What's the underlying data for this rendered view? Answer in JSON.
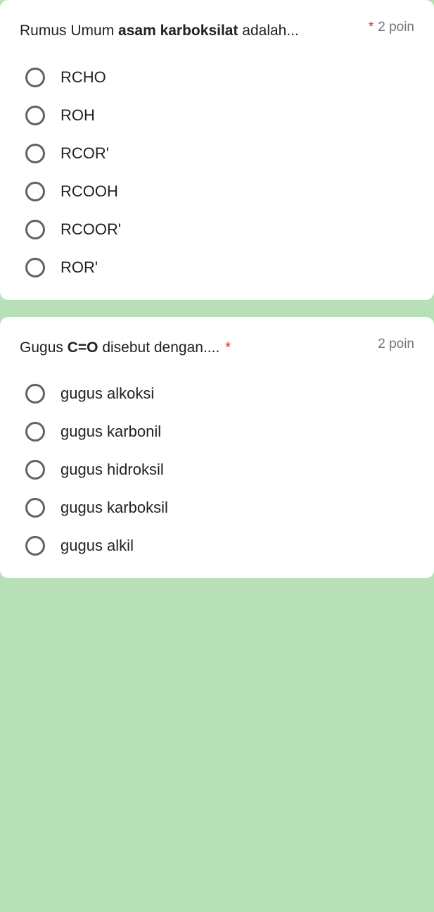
{
  "questions": [
    {
      "prompt_pre": "Rumus Umum ",
      "prompt_bold": "asam karboksilat",
      "prompt_post": " adalah...",
      "required": true,
      "points": "2 poin",
      "options": [
        "RCHO",
        "ROH",
        "RCOR'",
        "RCOOH",
        "RCOOR'",
        "ROR'"
      ]
    },
    {
      "prompt_pre": "Gugus ",
      "prompt_bold": "C=O",
      "prompt_post": " disebut dengan....",
      "required": true,
      "points": "2 poin",
      "options": [
        "gugus alkoksi",
        "gugus karbonil",
        "gugus hidroksil",
        "gugus karboksil",
        "gugus alkil"
      ]
    }
  ]
}
